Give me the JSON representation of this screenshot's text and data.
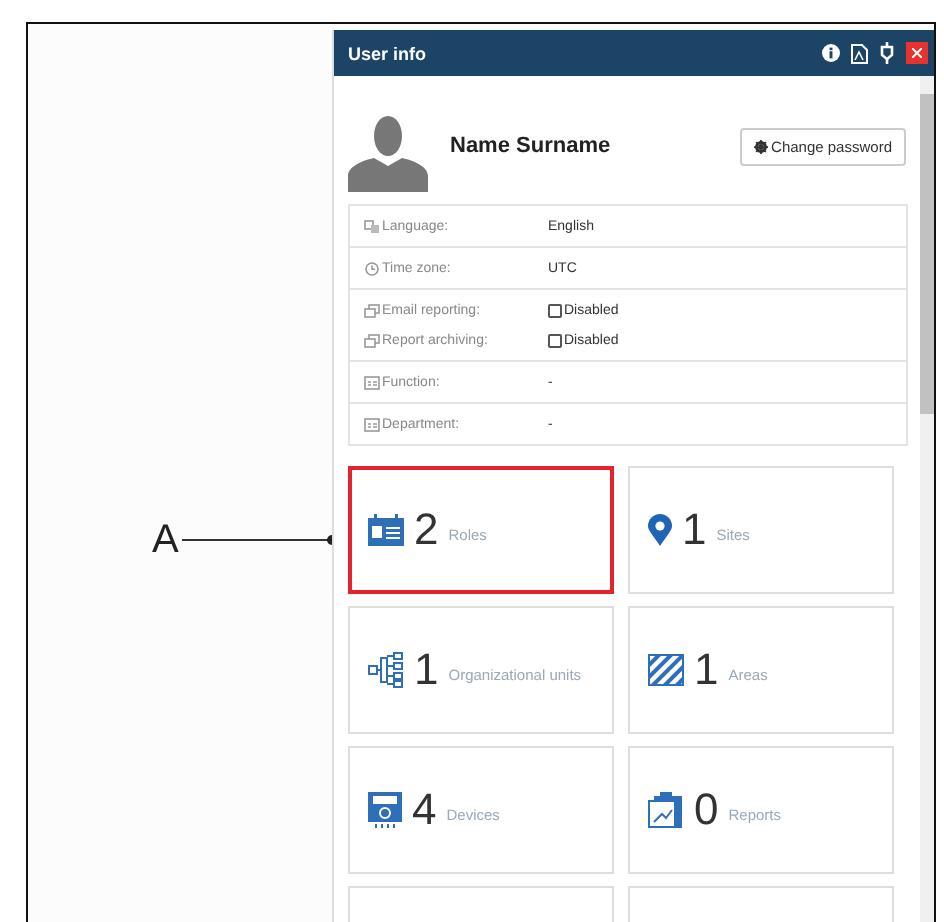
{
  "callout": {
    "label": "A"
  },
  "window": {
    "title": "User info"
  },
  "profile": {
    "name": "Name Surname",
    "change_password": "Change password"
  },
  "info_sections": [
    [
      {
        "kind": "text",
        "label": "Language:",
        "value": "English"
      }
    ],
    [
      {
        "kind": "text",
        "label": "Time zone:",
        "value": "UTC"
      }
    ],
    [
      {
        "kind": "checkbox",
        "label": "Email reporting:",
        "value": "Disabled",
        "checked": false
      },
      {
        "kind": "checkbox",
        "label": "Report archiving:",
        "value": "Disabled",
        "checked": false
      }
    ],
    [
      {
        "kind": "text",
        "label": "Function:",
        "value": "-"
      }
    ],
    [
      {
        "kind": "text",
        "label": "Department:",
        "value": "-"
      }
    ]
  ],
  "tiles": [
    {
      "kind": "roles",
      "count": "2",
      "label": "Roles",
      "selected": true
    },
    {
      "kind": "sites",
      "count": "1",
      "label": "Sites",
      "selected": false
    },
    {
      "kind": "units",
      "count": "1",
      "label": "Organizational units",
      "selected": false
    },
    {
      "kind": "areas",
      "count": "1",
      "label": "Areas",
      "selected": false
    },
    {
      "kind": "devices",
      "count": "4",
      "label": "Devices",
      "selected": false
    },
    {
      "kind": "reports",
      "count": "0",
      "label": "Reports",
      "selected": false
    }
  ]
}
